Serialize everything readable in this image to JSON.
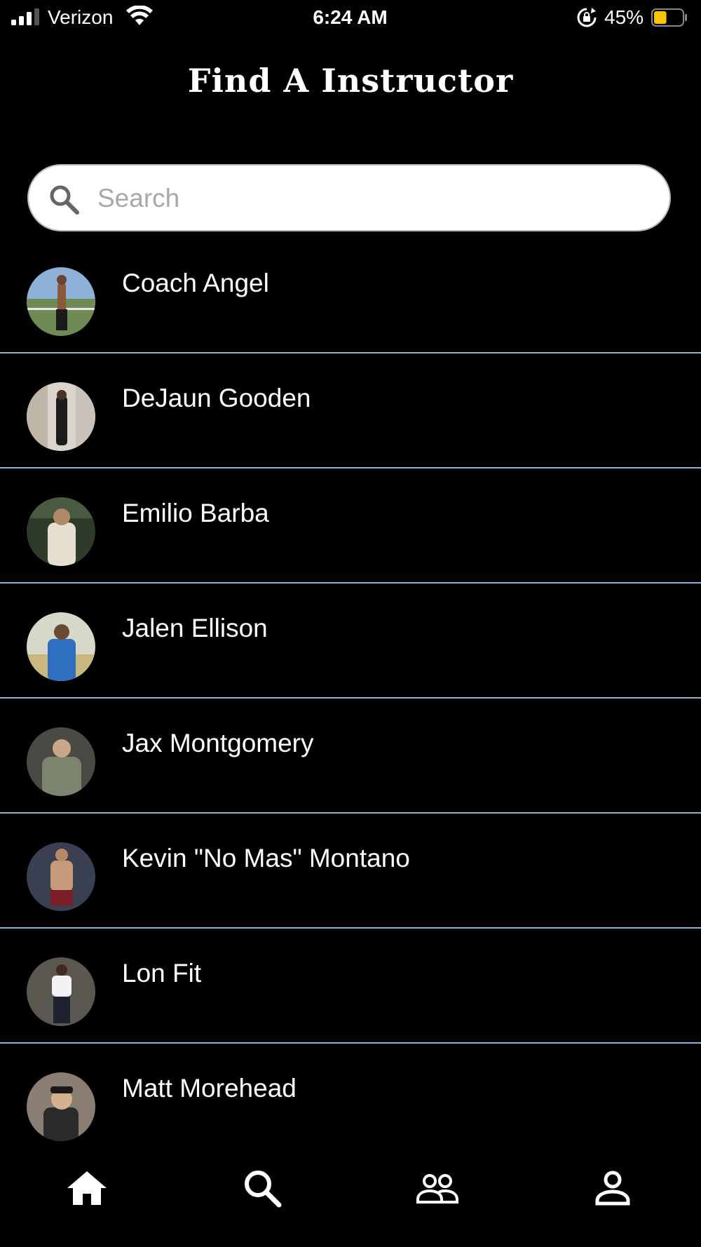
{
  "status_bar": {
    "carrier": "Verizon",
    "time": "6:24 AM",
    "battery_percent": "45%",
    "battery_level": 0.45,
    "battery_color": "#f7c500",
    "icons": [
      "cellular-signal-icon",
      "wifi-icon",
      "rotation-lock-icon",
      "battery-icon"
    ]
  },
  "header": {
    "title": "Find A Instructor"
  },
  "search": {
    "placeholder": "Search",
    "value": "",
    "icon": "search-icon"
  },
  "instructors": [
    {
      "name": "Coach Angel"
    },
    {
      "name": "DeJaun Gooden"
    },
    {
      "name": "Emilio Barba"
    },
    {
      "name": "Jalen Ellison"
    },
    {
      "name": "Jax Montgomery"
    },
    {
      "name": "Kevin \"No Mas\" Montano"
    },
    {
      "name": "Lon Fit"
    },
    {
      "name": "Matt Morehead"
    }
  ],
  "tab_bar": {
    "tabs": [
      {
        "icon": "home-icon"
      },
      {
        "icon": "search-icon"
      },
      {
        "icon": "community-icon"
      },
      {
        "icon": "profile-icon"
      }
    ]
  },
  "colors": {
    "background": "#000000",
    "divider": "#8ab3d6",
    "search_background": "#ffffff",
    "placeholder": "#a8a8a8"
  }
}
